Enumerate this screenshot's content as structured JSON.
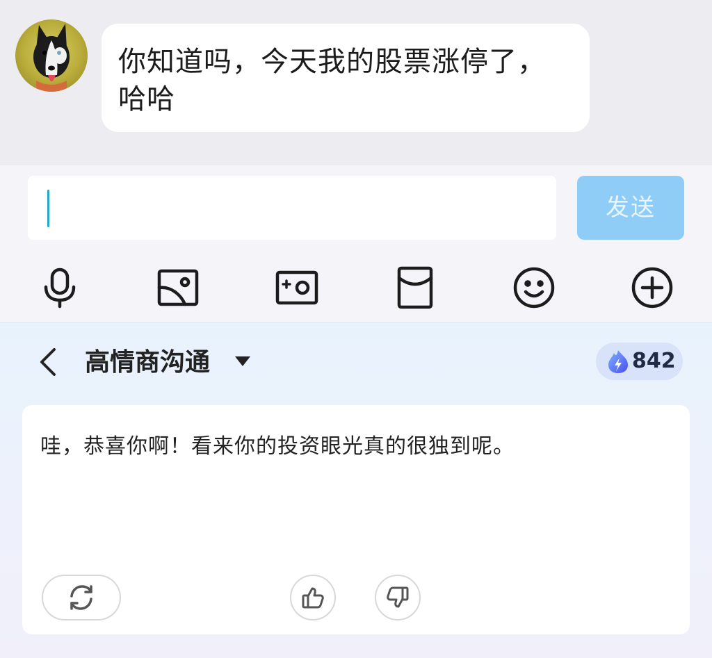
{
  "chat": {
    "incoming_message": "你知道吗，今天我的股票涨停了，哈哈",
    "avatar_icon": "dog-avatar-icon"
  },
  "composer": {
    "input_value": "",
    "send_label": "发送",
    "send_color": "#8fcdf6"
  },
  "toolbar": {
    "items": [
      {
        "icon": "microphone-icon"
      },
      {
        "icon": "image-icon"
      },
      {
        "icon": "camera-icon"
      },
      {
        "icon": "red-envelope-icon"
      },
      {
        "icon": "emoji-icon"
      },
      {
        "icon": "plus-icon"
      }
    ]
  },
  "assistant": {
    "mode_title": "高情商沟通",
    "credits": "842",
    "credit_icon": "flame-bolt-icon",
    "reply_text": "哇，恭喜你啊！看来你的投资眼光真的很独到呢。",
    "actions": {
      "refresh_icon": "refresh-icon",
      "like_icon": "thumbs-up-icon",
      "dislike_icon": "thumbs-down-icon"
    }
  }
}
